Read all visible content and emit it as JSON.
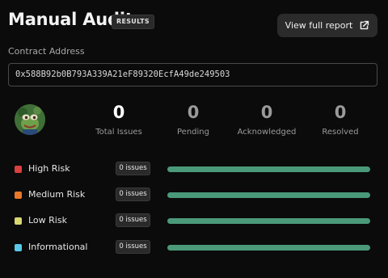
{
  "header": {
    "title": "Manual Audit",
    "badge": "RESULTS",
    "report_button": "View full report"
  },
  "contract": {
    "label": "Contract Address",
    "address": "0x588B92b0B793A339A21eF89320EcfA49de249503"
  },
  "stats": [
    {
      "value": "0",
      "label": "Total Issues"
    },
    {
      "value": "0",
      "label": "Pending"
    },
    {
      "value": "0",
      "label": "Acknowledged"
    },
    {
      "value": "0",
      "label": "Resolved"
    }
  ],
  "risks": [
    {
      "label": "High Risk",
      "issues": "0 issues",
      "color": "#d94040"
    },
    {
      "label": "Medium Risk",
      "issues": "0 issues",
      "color": "#e8782a"
    },
    {
      "label": "Low Risk",
      "issues": "0 issues",
      "color": "#d8d870"
    },
    {
      "label": "Informational",
      "issues": "0 issues",
      "color": "#5ac8e8"
    }
  ],
  "colors": {
    "stat_primary": "#ffffff",
    "stat_muted": "#9a9a9a",
    "bar": "#4a9a7a"
  },
  "icons": {
    "report": "external-link-icon",
    "avatar": "token-avatar"
  }
}
